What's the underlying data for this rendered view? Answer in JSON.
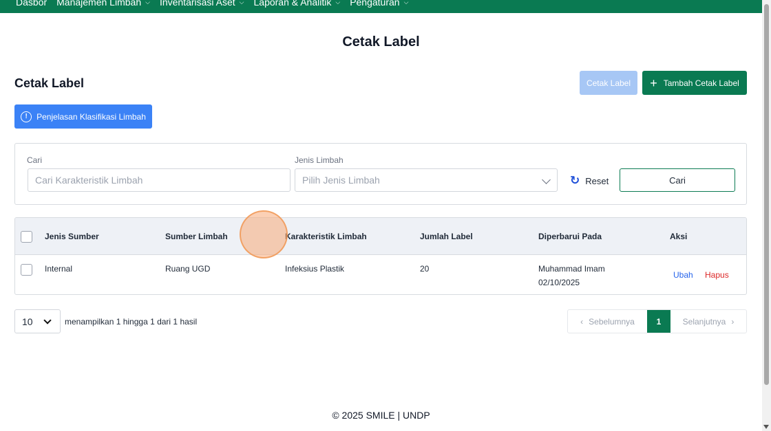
{
  "nav": {
    "items": [
      {
        "label": "Dasbor",
        "has_dropdown": false
      },
      {
        "label": "Manajemen Limbah",
        "has_dropdown": true
      },
      {
        "label": "Inventarisasi Aset",
        "has_dropdown": true
      },
      {
        "label": "Laporan & Analitik",
        "has_dropdown": true
      },
      {
        "label": "Pengaturan",
        "has_dropdown": true
      }
    ]
  },
  "page": {
    "title": "Cetak Label",
    "section_title": "Cetak Label"
  },
  "actions": {
    "print_label": "Cetak Label",
    "add_label": "Tambah Cetak Label",
    "info_button": "Penjelasan Klasifikasi Limbah"
  },
  "filters": {
    "search_label": "Cari",
    "search_placeholder": "Cari Karakteristik Limbah",
    "type_label": "Jenis Limbah",
    "type_placeholder": "Pilih Jenis Limbah",
    "reset_label": "Reset",
    "search_button": "Cari"
  },
  "table": {
    "headers": [
      "Jenis Sumber",
      "Sumber Limbah",
      "Karakteristik Limbah",
      "Jumlah Label",
      "Diperbarui Pada",
      "Aksi"
    ],
    "rows": [
      {
        "jenis_sumber": "Internal",
        "sumber_limbah": "Ruang UGD",
        "karakteristik": "Infeksius Plastik",
        "jumlah": "20",
        "updated_by": "Muhammad Imam",
        "updated_date": "02/10/2025",
        "edit_label": "Ubah",
        "delete_label": "Hapus"
      }
    ]
  },
  "pagination": {
    "per_page": "10",
    "summary": "menampilkan 1 hingga 1 dari 1 hasil",
    "prev_label": "Sebelumnya",
    "current_page": "1",
    "next_label": "Selanjutnya"
  },
  "footer": {
    "text": "© 2025 SMILE | UNDP"
  },
  "colors": {
    "brand_green": "#0a7a52",
    "info_blue": "#3b82f6",
    "disabled_blue": "#a7c7f5",
    "delete_red": "#dc2626"
  }
}
